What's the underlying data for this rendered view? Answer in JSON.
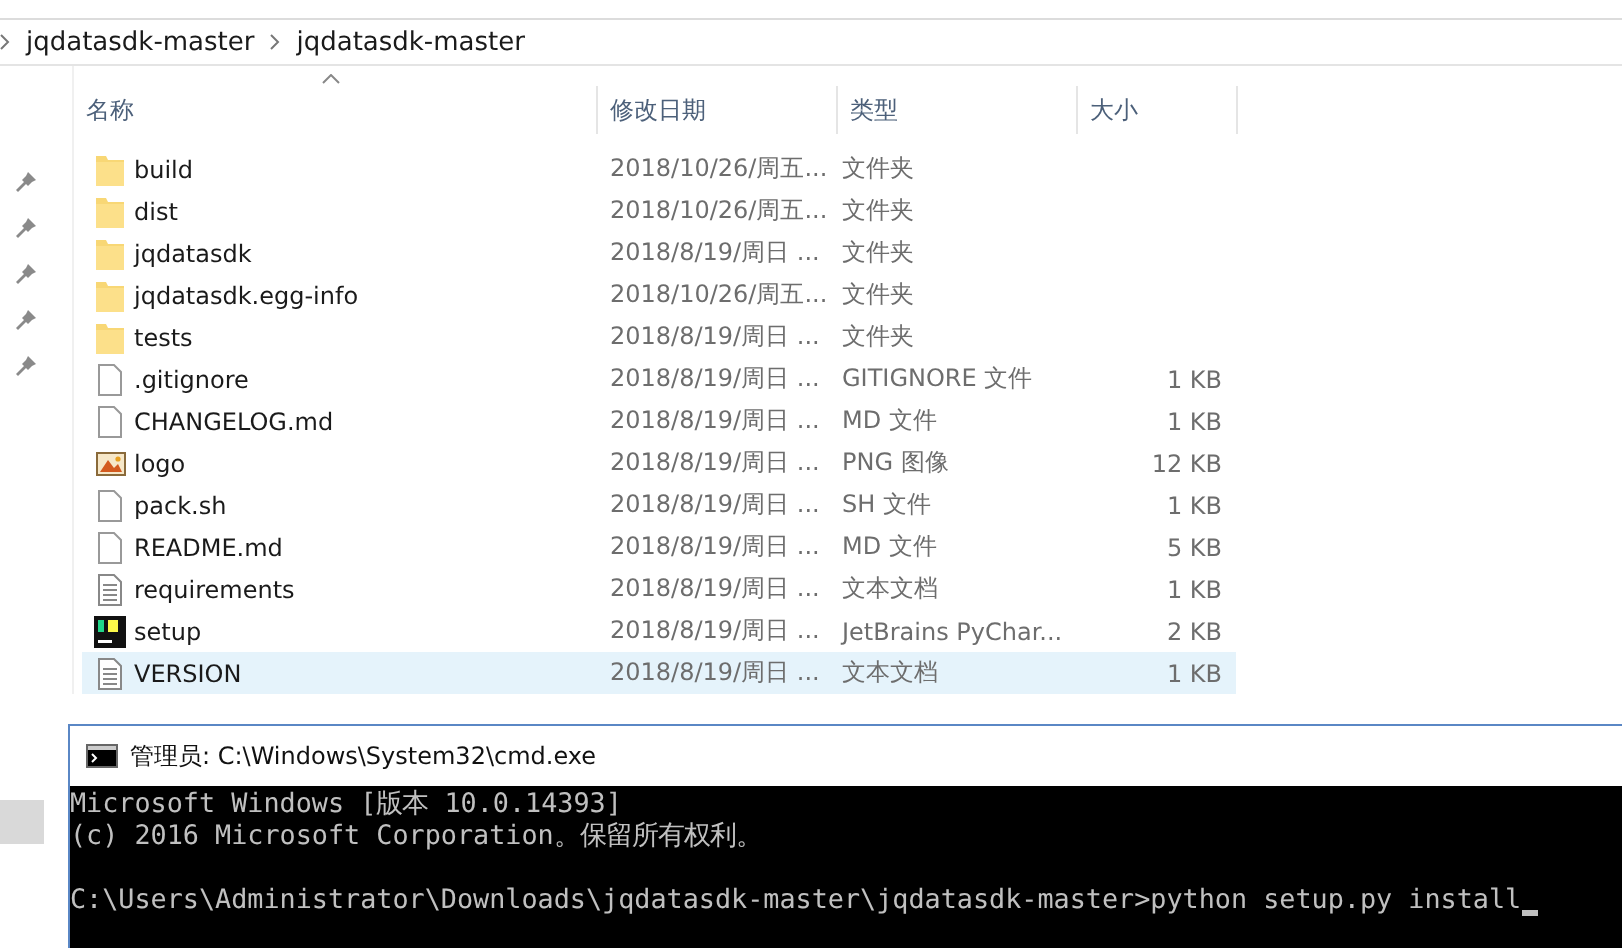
{
  "breadcrumb": [
    "jqdatasdk-master",
    "jqdatasdk-master"
  ],
  "columns": [
    "名称",
    "修改日期",
    "类型",
    "大小"
  ],
  "files": [
    {
      "kind": "folder",
      "name": "build",
      "date": "2018/10/26/周五...",
      "type": "文件夹",
      "selected": false
    },
    {
      "kind": "folder",
      "name": "dist",
      "date": "2018/10/26/周五...",
      "type": "文件夹",
      "selected": false
    },
    {
      "kind": "folder",
      "name": "jqdatasdk",
      "date": "2018/8/19/周日 ...",
      "type": "文件夹",
      "selected": false
    },
    {
      "kind": "folder",
      "name": "jqdatasdk.egg-info",
      "date": "2018/10/26/周五...",
      "type": "文件夹",
      "selected": false
    },
    {
      "kind": "folder",
      "name": "tests",
      "date": "2018/8/19/周日 ...",
      "type": "文件夹",
      "selected": false
    },
    {
      "kind": "file",
      "name": ".gitignore",
      "date": "2018/8/19/周日 ...",
      "type": "GITIGNORE 文件",
      "size": "1 KB",
      "selected": false
    },
    {
      "kind": "file",
      "name": "CHANGELOG.md",
      "date": "2018/8/19/周日 ...",
      "type": "MD 文件",
      "size": "1 KB",
      "selected": false
    },
    {
      "kind": "image",
      "name": "logo",
      "date": "2018/8/19/周日 ...",
      "type": "PNG 图像",
      "size": "12 KB",
      "selected": false
    },
    {
      "kind": "file",
      "name": "pack.sh",
      "date": "2018/8/19/周日 ...",
      "type": "SH 文件",
      "size": "1 KB",
      "selected": false
    },
    {
      "kind": "file",
      "name": "README.md",
      "date": "2018/8/19/周日 ...",
      "type": "MD 文件",
      "size": "5 KB",
      "selected": false
    },
    {
      "kind": "text",
      "name": "requirements",
      "date": "2018/8/19/周日 ...",
      "type": "文本文档",
      "size": "1 KB",
      "selected": false
    },
    {
      "kind": "pycharm",
      "name": "setup",
      "date": "2018/8/19/周日 ...",
      "type": "JetBrains PyChar...",
      "size": "2 KB",
      "selected": false
    },
    {
      "kind": "text",
      "name": "VERSION",
      "date": "2018/8/19/周日 ...",
      "type": "文本文档",
      "size": "1 KB",
      "selected": true
    }
  ],
  "console": {
    "title": "管理员: C:\\Windows\\System32\\cmd.exe",
    "banner": [
      "Microsoft Windows [版本 10.0.14393]",
      "(c) 2016 Microsoft Corporation。保留所有权利。"
    ],
    "prompt": "C:\\Users\\Administrator\\Downloads\\jqdatasdk-master\\jqdatasdk-master>python setup.py install"
  }
}
